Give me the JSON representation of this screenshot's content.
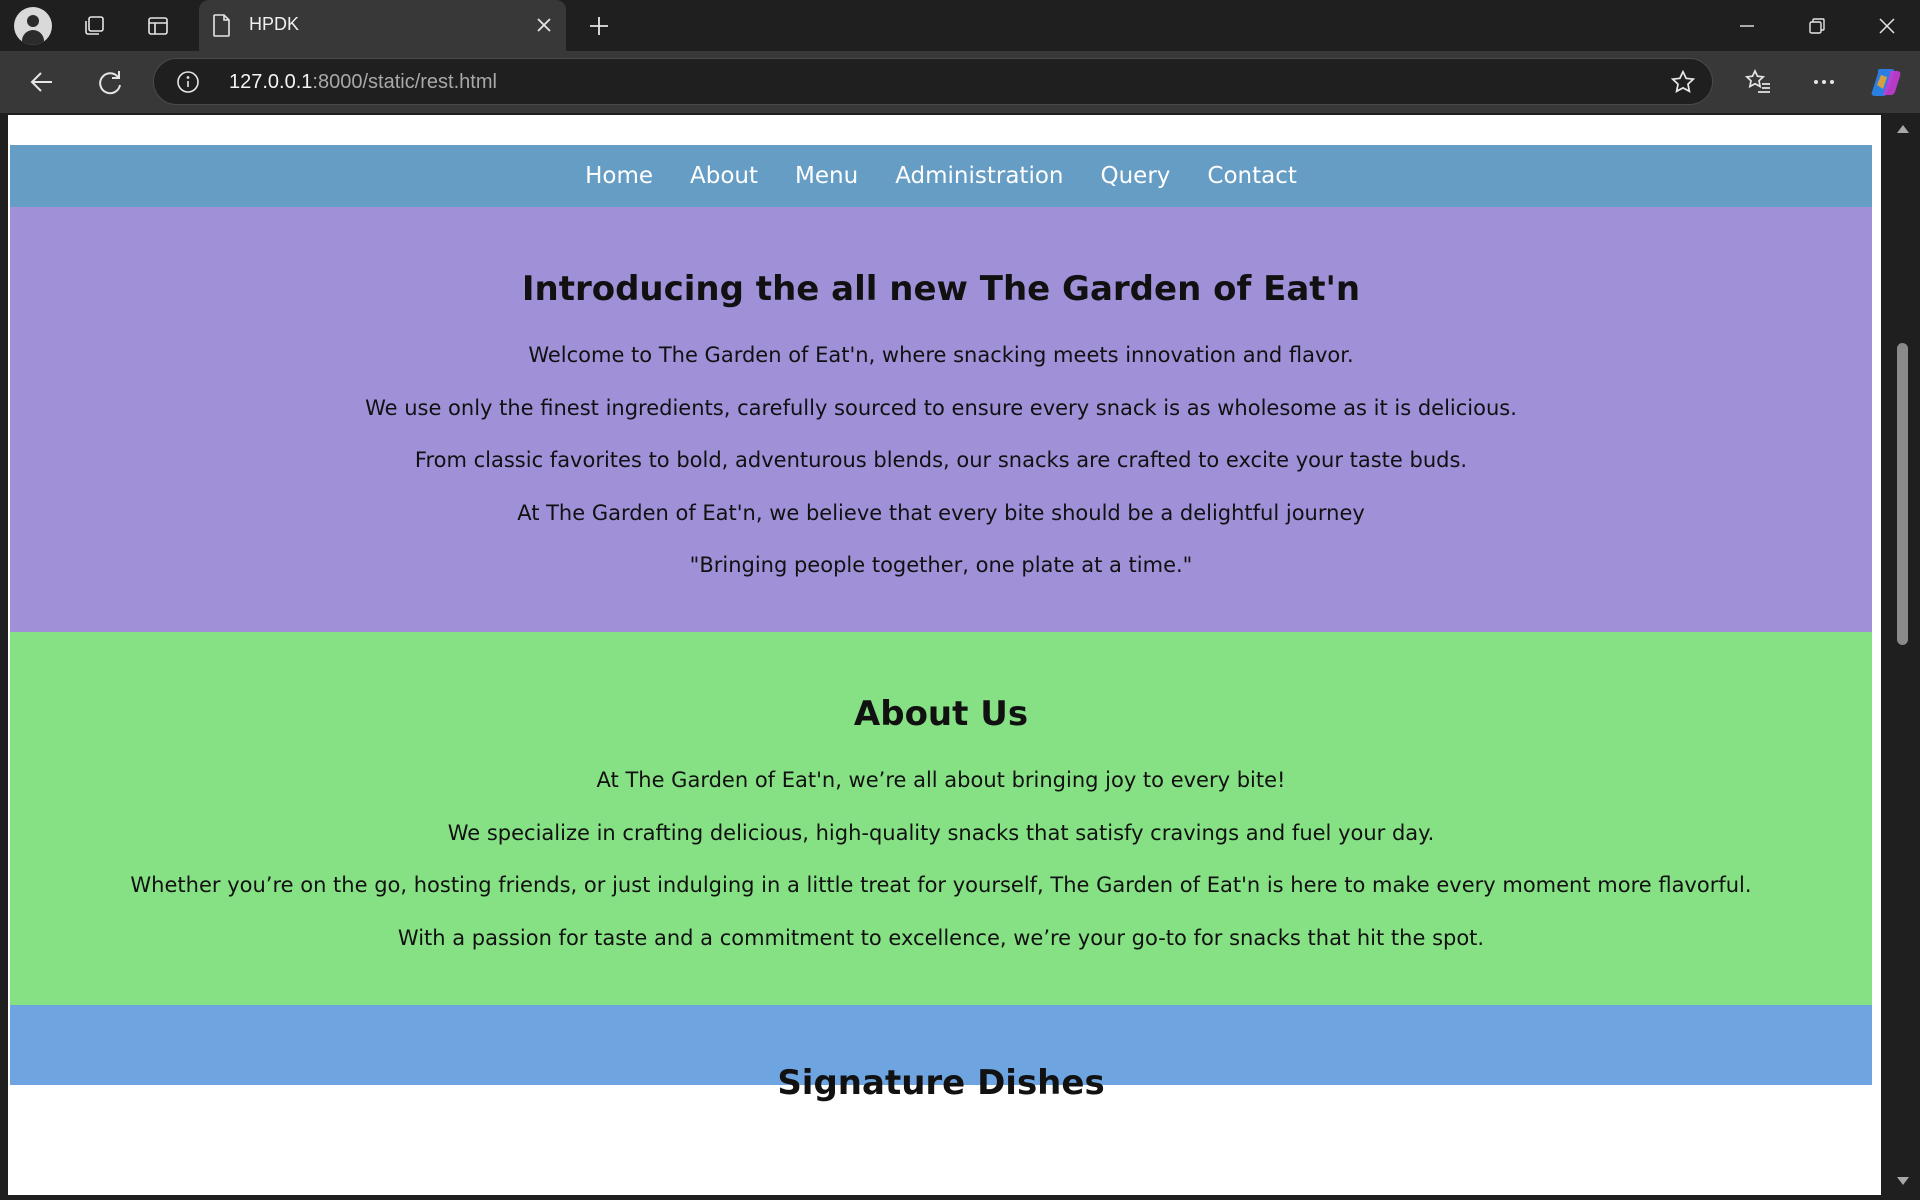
{
  "browser": {
    "tab": {
      "title": "HPDK"
    },
    "address": {
      "host": "127.0.0.1",
      "path": ":8000/static/rest.html"
    },
    "icons": [
      "profile-avatar",
      "workspaces-icon",
      "tab-actions-icon",
      "page-icon",
      "close-icon",
      "new-tab-icon",
      "minimize-icon",
      "restore-icon",
      "window-close-icon",
      "back-icon",
      "refresh-icon",
      "info-icon",
      "favorite-star-icon",
      "favorites-icon",
      "more-icon",
      "copilot-icon"
    ]
  },
  "nav": {
    "items": [
      "Home",
      "About",
      "Menu",
      "Administration",
      "Query",
      "Contact"
    ]
  },
  "intro": {
    "heading": "Introducing the all new The Garden of Eat'n",
    "paragraphs": [
      "Welcome to The Garden of Eat'n, where snacking meets innovation and flavor.",
      "We use only the finest ingredients, carefully sourced to ensure every snack is as wholesome as it is delicious.",
      "From classic favorites to bold, adventurous blends, our snacks are crafted to excite your taste buds.",
      "At The Garden of Eat'n, we believe that every bite should be a delightful journey",
      "\"Bringing people together, one plate at a time.\""
    ]
  },
  "about": {
    "heading": "About Us",
    "paragraphs": [
      "At The Garden of Eat'n, we’re all about bringing joy to every bite!",
      "We specialize in crafting delicious, high-quality snacks that satisfy cravings and fuel your day.",
      "Whether you’re on the go, hosting friends, or just indulging in a little treat for yourself, The Garden of Eat'n is here to make every moment more flavorful.",
      "With a passion for taste and a commitment to excellence, we’re your go-to for snacks that hit the spot."
    ]
  },
  "dishes": {
    "heading": "Signature Dishes"
  },
  "colors": {
    "nav": "#669dc5",
    "intro": "#a090d8",
    "about": "#86e084",
    "dishes": "#6ea4e0"
  }
}
